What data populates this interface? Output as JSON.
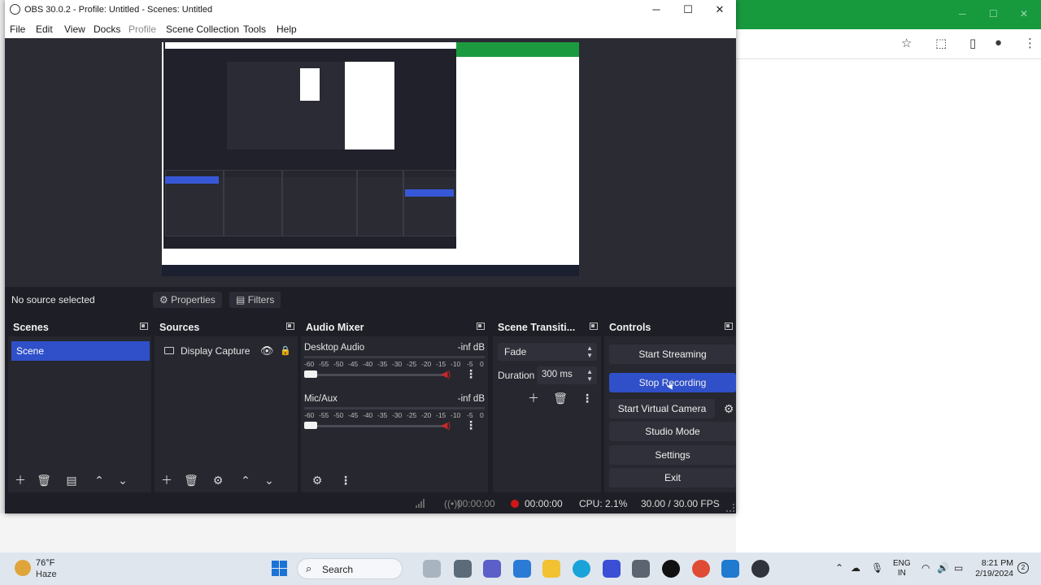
{
  "window": {
    "title": "OBS 30.0.2 - Profile: Untitled - Scenes: Untitled",
    "minimize": "─",
    "maximize": "☐",
    "close": "✕"
  },
  "menu": [
    "File",
    "Edit",
    "View",
    "Docks",
    "Profile",
    "Scene Collection",
    "Tools",
    "Help"
  ],
  "source_toolbar": {
    "no_source": "No source selected",
    "properties": "Properties",
    "filters": "Filters"
  },
  "docks": {
    "scenes": {
      "title": "Scenes",
      "items": [
        "Scene"
      ]
    },
    "sources": {
      "title": "Sources",
      "items": [
        "Display Capture"
      ]
    },
    "audio_mixer": {
      "title": "Audio Mixer",
      "channels": [
        {
          "name": "Desktop Audio",
          "level": "-inf dB"
        },
        {
          "name": "Mic/Aux",
          "level": "-inf dB"
        }
      ],
      "scale": [
        "-60",
        "-55",
        "-50",
        "-45",
        "-40",
        "-35",
        "-30",
        "-25",
        "-20",
        "-15",
        "-10",
        "-5",
        "0"
      ]
    },
    "transitions": {
      "title": "Scene Transiti...",
      "selected": "Fade",
      "duration_label": "Duration",
      "duration_value": "300 ms"
    },
    "controls": {
      "title": "Controls",
      "start_streaming": "Start Streaming",
      "stop_recording": "Stop Recording",
      "start_virtual_camera": "Start Virtual Camera",
      "studio_mode": "Studio Mode",
      "settings": "Settings",
      "exit": "Exit"
    }
  },
  "status": {
    "stream_time": "00:00:00",
    "rec_time": "00:00:00",
    "cpu": "CPU: 2.1%",
    "fps": "30.00 / 30.00 FPS"
  },
  "taskbar": {
    "temp": "76°F",
    "condition": "Haze",
    "search": "Search",
    "lang_line1": "ENG",
    "lang_line2": "IN",
    "time": "8:21 PM",
    "date": "2/19/2024"
  },
  "colors": {
    "accent_blue": "#2f50c8",
    "obs_bg": "#1e1f26",
    "dock_bg": "#26272f",
    "record_red": "#d01616",
    "browser_green": "#179a3e"
  }
}
